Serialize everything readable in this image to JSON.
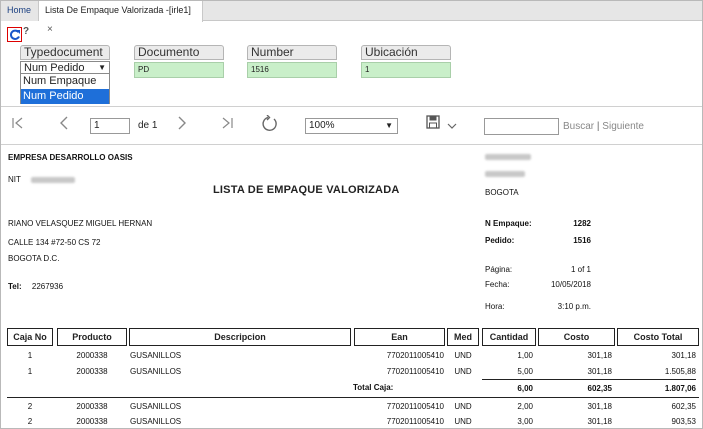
{
  "tabs": {
    "home": "Home",
    "active": "Lista De Empaque Valorizada -[irle1]",
    "close": "×"
  },
  "toolbar": {
    "help": "?",
    "params": {
      "typedocument": {
        "label": "Typedocument",
        "value": "Num Pedido",
        "options": [
          "Num Empaque",
          "Num Pedido"
        ],
        "selected_option": "Num Pedido"
      },
      "documento": {
        "label": "Documento",
        "value": "PD"
      },
      "number": {
        "label": "Number",
        "value": "1516"
      },
      "ubicacion": {
        "label": "Ubicación",
        "value": "1"
      }
    }
  },
  "viewer": {
    "page_input": "1",
    "page_of": "de 1",
    "zoom": "100%",
    "search_link": "Buscar",
    "separator": "|",
    "next_link": "Siguiente"
  },
  "report": {
    "company": "EMPRESA DESARROLLO OASIS",
    "nit_label": "NIT",
    "title": "LISTA DE EMPAQUE VALORIZADA",
    "city": "BOGOTA",
    "customer_name": "RIANO VELASQUEZ MIGUEL HERNAN",
    "customer_address": "CALLE 134 #72-50 CS 72",
    "customer_city": "BOGOTA D.C.",
    "tel_label": "Tel:",
    "tel": "2267936",
    "n_empaque_label": "N Empaque:",
    "n_empaque": "1282",
    "pedido_label": "Pedido:",
    "pedido": "1516",
    "pagina_label": "Página:",
    "pagina": "1 of 1",
    "fecha_label": "Fecha:",
    "fecha": "10/05/2018",
    "hora_label": "Hora:",
    "hora": "3:10 p.m.",
    "columns": [
      "Caja No",
      "Producto",
      "Descripcion",
      "Ean",
      "Med",
      "Cantidad",
      "Costo",
      "Costo Total"
    ],
    "rows": [
      {
        "caja": "1",
        "producto": "2000338",
        "descripcion": "GUSANILLOS",
        "ean": "7702011005410",
        "med": "UND",
        "cantidad": "1,00",
        "costo": "301,18",
        "total": "301,18"
      },
      {
        "caja": "1",
        "producto": "2000338",
        "descripcion": "GUSANILLOS",
        "ean": "7702011005410",
        "med": "UND",
        "cantidad": "5,00",
        "costo": "301,18",
        "total": "1.505,88"
      },
      {
        "caja": "2",
        "producto": "2000338",
        "descripcion": "GUSANILLOS",
        "ean": "7702011005410",
        "med": "UND",
        "cantidad": "2,00",
        "costo": "301,18",
        "total": "602,35"
      },
      {
        "caja": "2",
        "producto": "2000338",
        "descripcion": "GUSANILLOS",
        "ean": "7702011005410",
        "med": "UND",
        "cantidad": "3,00",
        "costo": "301,18",
        "total": "903,53"
      }
    ],
    "subtotal": {
      "label": "Total Caja:",
      "cantidad": "6,00",
      "costo": "602,35",
      "total": "1.807,06"
    }
  }
}
